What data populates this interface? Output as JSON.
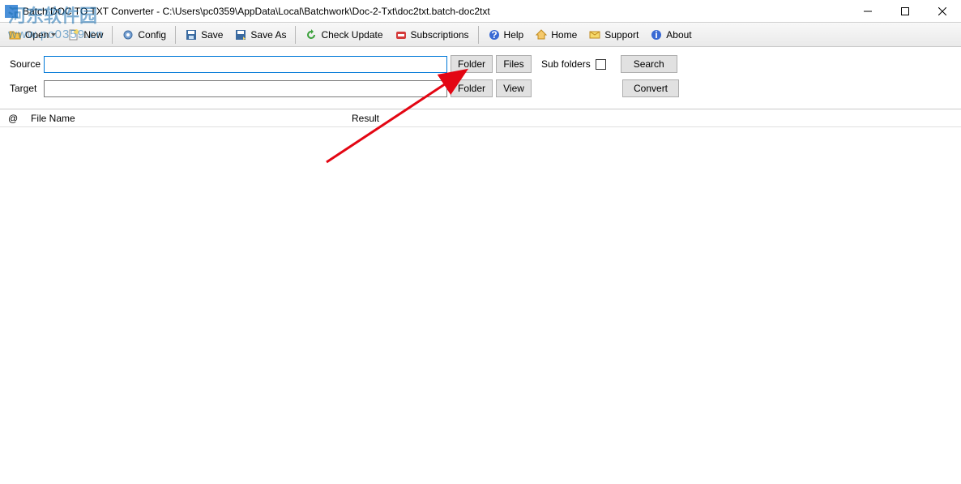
{
  "window": {
    "title": "Batch DOC TO TXT Converter - C:\\Users\\pc0359\\AppData\\Local\\Batchwork\\Doc-2-Txt\\doc2txt.batch-doc2txt"
  },
  "toolbar": {
    "open": "Open",
    "new": "New",
    "config": "Config",
    "save": "Save",
    "saveas": "Save As",
    "check": "Check Update",
    "subs": "Subscriptions",
    "help": "Help",
    "home": "Home",
    "support": "Support",
    "about": "About"
  },
  "form": {
    "source_label": "Source",
    "source_value": "",
    "target_label": "Target",
    "target_value": "",
    "folder_btn": "Folder",
    "files_btn": "Files",
    "view_btn": "View",
    "subfolders_label": "Sub folders",
    "search_btn": "Search",
    "convert_btn": "Convert"
  },
  "table": {
    "at": "@",
    "filename": "File Name",
    "result": "Result"
  },
  "watermark": {
    "cn": "河东软件园",
    "url": "www.pc0359.cn"
  }
}
